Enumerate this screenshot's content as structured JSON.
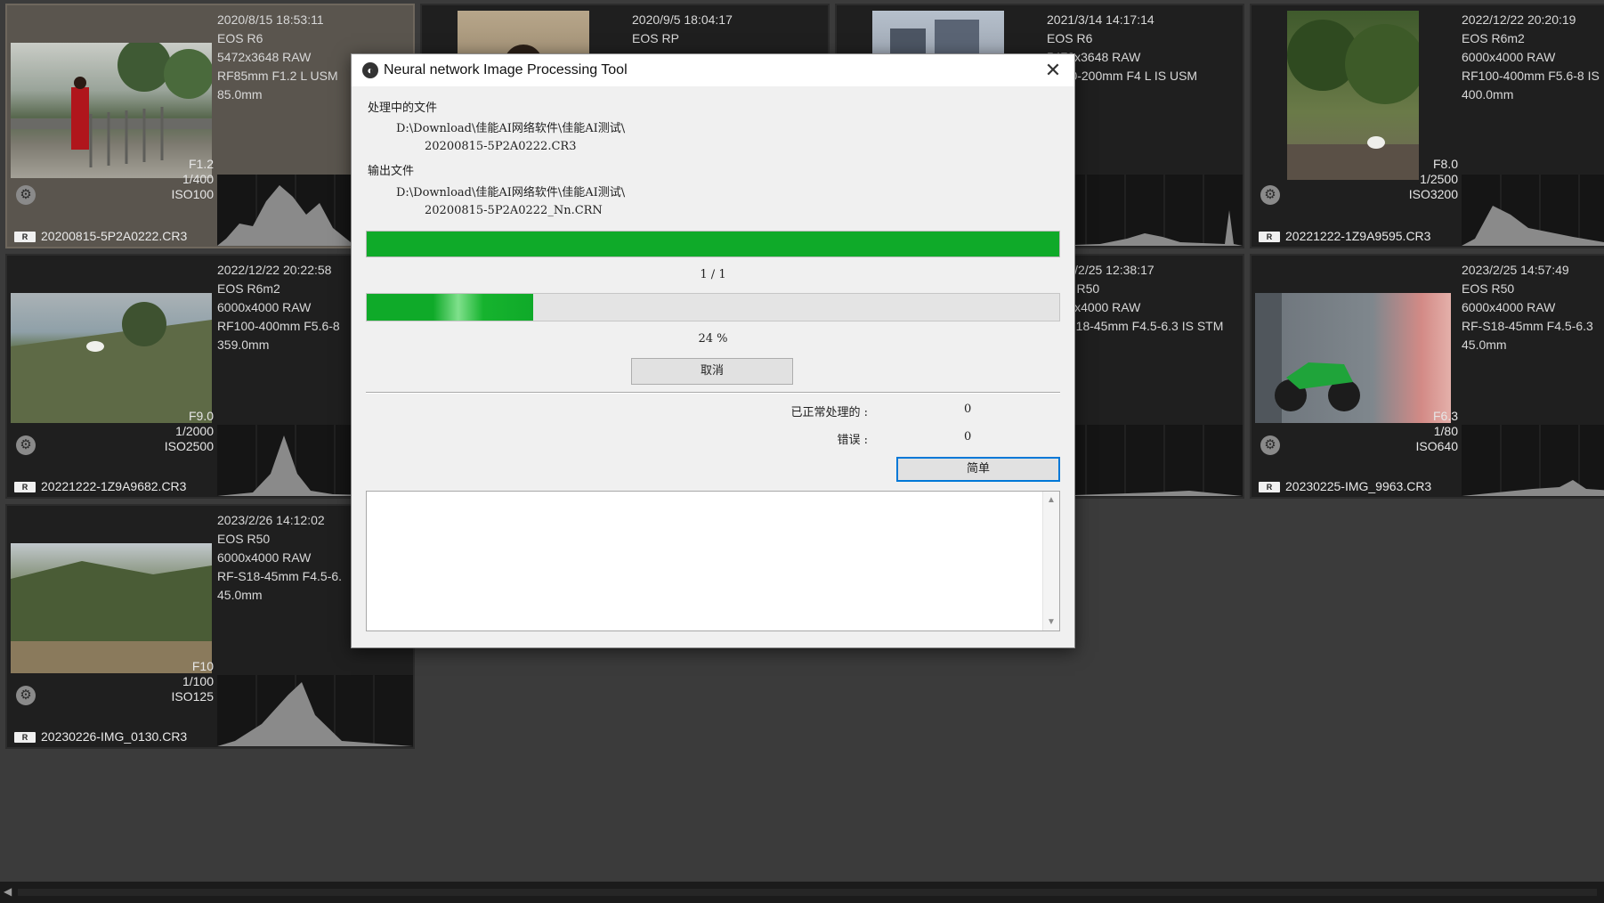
{
  "photos": [
    {
      "datetime": "2020/8/15 18:53:11",
      "camera": "EOS R6",
      "size": "5472x3648 RAW",
      "lens": "RF85mm F1.2 L USM",
      "focal": "85.0mm",
      "aperture": "F1.2",
      "shutter": "1/400",
      "iso": "ISO100",
      "filename": "20200815-5P2A0222.CR3"
    },
    {
      "datetime": "2020/9/5 18:04:17",
      "camera": "EOS RP",
      "size": "",
      "lens": "",
      "focal": "",
      "aperture": "",
      "shutter": "",
      "iso": "",
      "filename": ""
    },
    {
      "datetime": "2021/3/14 14:17:14",
      "camera": "EOS R6",
      "size": "5472x3648 RAW",
      "lens": "RF70-200mm F4 L IS USM",
      "focal": "",
      "aperture": "",
      "shutter": "",
      "iso": "",
      "filename": ""
    },
    {
      "datetime": "2022/12/22 20:20:19",
      "camera": "EOS R6m2",
      "size": "6000x4000 RAW",
      "lens": "RF100-400mm F5.6-8 IS",
      "focal": "400.0mm",
      "aperture": "F8.0",
      "shutter": "1/2500",
      "iso": "ISO3200",
      "filename": "20221222-1Z9A9595.CR3"
    },
    {
      "datetime": "2022/12/22 20:22:58",
      "camera": "EOS R6m2",
      "size": "6000x4000 RAW",
      "lens": "RF100-400mm F5.6-8",
      "focal": "359.0mm",
      "aperture": "F9.0",
      "shutter": "1/2000",
      "iso": "ISO2500",
      "filename": "20221222-1Z9A9682.CR3"
    },
    {
      "datetime": "2023/2/25 12:38:17",
      "camera": "EOS R50",
      "size": "6000x4000 RAW",
      "lens": "RF-S18-45mm F4.5-6.3 IS STM",
      "focal": "",
      "aperture": "",
      "shutter": "",
      "iso": "",
      "filename": ""
    },
    {
      "datetime": "2023/2/25 14:57:49",
      "camera": "EOS R50",
      "size": "6000x4000 RAW",
      "lens": "RF-S18-45mm F4.5-6.3",
      "focal": "45.0mm",
      "aperture": "F6.3",
      "shutter": "1/80",
      "iso": "ISO640",
      "filename": "20230225-IMG_9963.CR3"
    },
    {
      "datetime": "2023/2/26 14:12:02",
      "camera": "EOS R50",
      "size": "6000x4000 RAW",
      "lens": "RF-S18-45mm F4.5-6.",
      "focal": "45.0mm",
      "aperture": "F10",
      "shutter": "1/100",
      "iso": "ISO125",
      "filename": "20230226-IMG_0130.CR3"
    }
  ],
  "raw_badge": "R",
  "dialog": {
    "title": "Neural network Image Processing Tool",
    "processing_label": "处理中的文件",
    "processing_path": "D:\\Download\\佳能AI网络软件\\佳能AI测试\\",
    "processing_file": "20200815-5P2A0222.CR3",
    "output_label": "输出文件",
    "output_path": "D:\\Download\\佳能AI网络软件\\佳能AI测试\\",
    "output_file": "20200815-5P2A0222_Nn.CRN",
    "count_text": "1 / 1",
    "overall_progress": 1.0,
    "file_progress": 0.24,
    "percent_text": "24 %",
    "cancel_label": "取消",
    "success_label": "已正常处理的 :",
    "success_count": "0",
    "error_label": "错误 :",
    "error_count": "0",
    "simple_label": "简单"
  },
  "colors": {
    "progress_green": "#0faa29",
    "background": "#3b3b3b"
  }
}
